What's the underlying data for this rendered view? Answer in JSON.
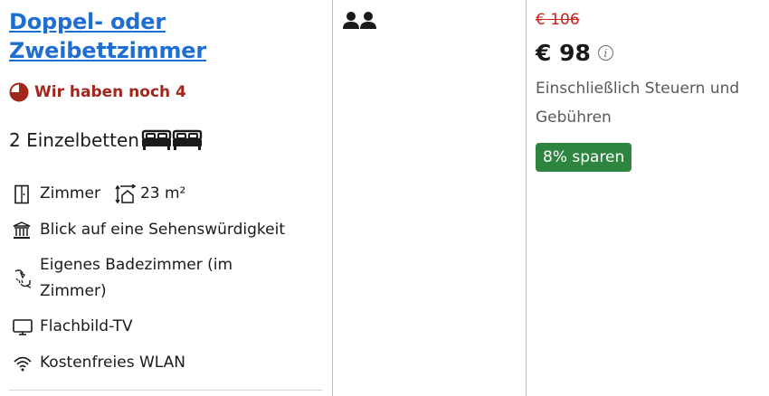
{
  "room": {
    "title": "Doppel- oder Zweibettzimmer",
    "scarcity": "Wir haben noch 4",
    "beds": "2 Einzelbetten",
    "room_label": "Zimmer",
    "size": "23 m²",
    "features": [
      {
        "icon": "landmark-icon",
        "label": "Blick auf eine Sehenswürdigkeit"
      },
      {
        "icon": "shower-icon",
        "label": "Eigenes Badezimmer (im Zimmer)"
      },
      {
        "icon": "tv-icon",
        "label": "Flachbild-TV"
      },
      {
        "icon": "wifi-icon",
        "label": "Kostenfreies WLAN"
      }
    ]
  },
  "occupancy": {
    "icon": "two-persons-icon"
  },
  "price": {
    "original": "€ 106",
    "current": "€ 98",
    "taxes_note": "Einschließlich Steuern und Gebühren",
    "discount_badge": "8% sparen"
  },
  "colors": {
    "link": "#1f6ed1",
    "scarcity": "#a3261c",
    "old_price": "#c4221b",
    "badge": "#2e8540",
    "column_separator": "#8fd1cc"
  }
}
